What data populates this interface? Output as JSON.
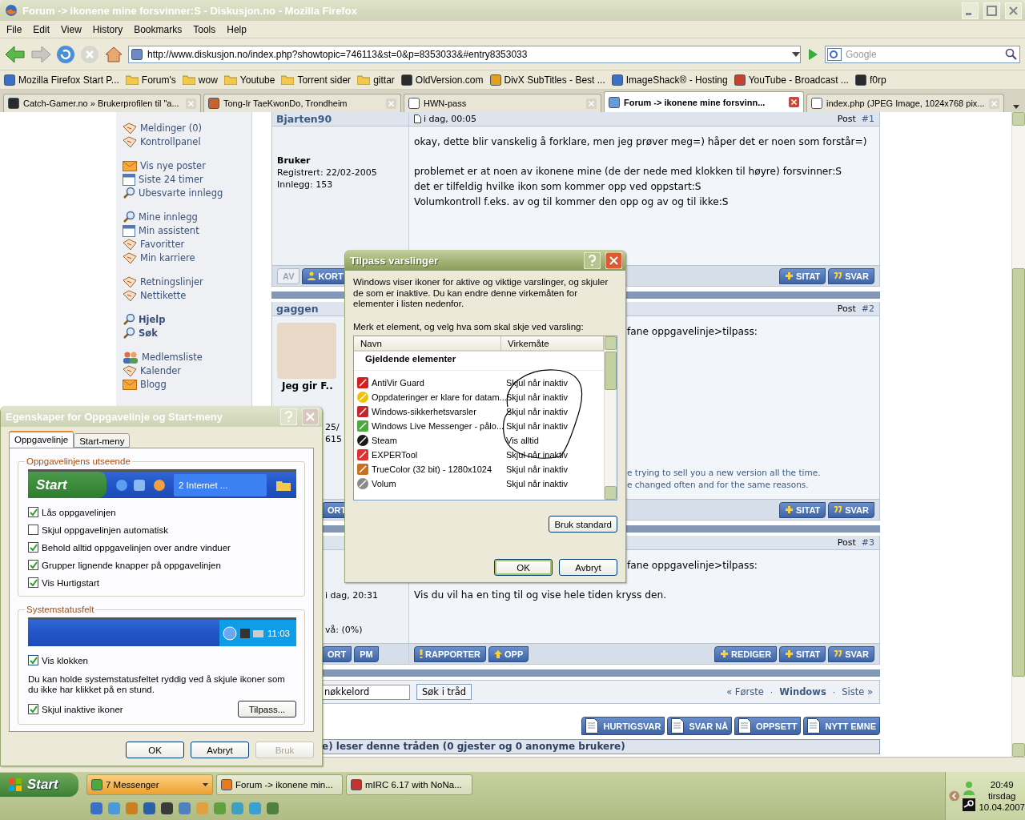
{
  "window": {
    "title": "Forum -> ikonene mine forsvinner:S - Diskusjon.no - Mozilla Firefox"
  },
  "menu": [
    "File",
    "Edit",
    "View",
    "History",
    "Bookmarks",
    "Tools",
    "Help"
  ],
  "address": {
    "url": "http://www.diskusjon.no/index.php?showtopic=746113&st=0&p=8353033&#entry8353033"
  },
  "search": {
    "placeholder": "Google"
  },
  "bookmarks": [
    {
      "label": "Mozilla Firefox Start P...",
      "kind": "page"
    },
    {
      "label": "Forum's",
      "kind": "folder"
    },
    {
      "label": "wow",
      "kind": "folder"
    },
    {
      "label": "Youtube",
      "kind": "folder"
    },
    {
      "label": "Torrent sider",
      "kind": "folder"
    },
    {
      "label": "gittar",
      "kind": "folder"
    },
    {
      "label": "OldVersion.com",
      "kind": "page"
    },
    {
      "label": "DivX SubTitles - Best ...",
      "kind": "page"
    },
    {
      "label": "ImageShack® - Hosting",
      "kind": "page"
    },
    {
      "label": "YouTube - Broadcast ...",
      "kind": "page"
    },
    {
      "label": "f0rp",
      "kind": "page"
    }
  ],
  "tabs": [
    {
      "label": "Catch-Gamer.no » Brukerprofilen til \"a...",
      "selected": false
    },
    {
      "label": "Tong-Ir TaeKwonDo, Trondheim",
      "selected": false
    },
    {
      "label": "HWN-pass",
      "selected": false
    },
    {
      "label": "Forum -> ikonene mine forsvinn...",
      "selected": true
    },
    {
      "label": "index.php (JPEG Image, 1024x768 pix...",
      "selected": false
    }
  ],
  "sidebar": {
    "groups": [
      [
        {
          "label": "Meldinger (0)",
          "kind": "page",
          "bold": false
        },
        {
          "label": "Kontrollpanel",
          "kind": "page",
          "bold": false
        }
      ],
      [
        {
          "label": "Vis nye poster",
          "kind": "mail",
          "bold": false
        },
        {
          "label": "Siste 24 timer",
          "kind": "calendar",
          "bold": false
        },
        {
          "label": "Ubesvarte innlegg",
          "kind": "search",
          "bold": false
        }
      ],
      [
        {
          "label": "Mine innlegg",
          "kind": "search",
          "bold": false
        },
        {
          "label": "Min assistent",
          "kind": "calendar",
          "bold": false
        },
        {
          "label": "Favoritter",
          "kind": "page",
          "bold": false
        },
        {
          "label": "Min karriere",
          "kind": "page",
          "bold": false
        }
      ],
      [
        {
          "label": "Retningslinjer",
          "kind": "page",
          "bold": false
        },
        {
          "label": "Nettikette",
          "kind": "page",
          "bold": false
        }
      ],
      [
        {
          "label": "Hjelp",
          "kind": "search",
          "bold": true
        },
        {
          "label": "Søk",
          "kind": "search",
          "bold": true
        }
      ],
      [
        {
          "label": "Medlemsliste",
          "kind": "people",
          "bold": false
        },
        {
          "label": "Kalender",
          "kind": "page",
          "bold": false
        },
        {
          "label": "Blogg",
          "kind": "mail",
          "bold": false
        }
      ]
    ]
  },
  "posts": [
    {
      "author": "Bjarten90",
      "date": "i dag, 00:05",
      "post_label": "Post",
      "post_number": "#1",
      "role": "Bruker",
      "details": [
        "Registrert: 22/02-2005",
        "Innlegg: 153"
      ],
      "message": [
        [
          "okay, dette blir vanskelig å forklare, men jeg prøver meg=) håper det er noen som forstår=)"
        ],
        [
          "problemet er at noen av ikonene mine (de der nede med klokken til høyre) forsvinner:S",
          "det er tilfeldig hvilke ikon som kommer opp ved oppstart:S",
          "Volumkontroll f.eks. av og til kommer den opp og av og til ikke:S"
        ]
      ],
      "left_buttons": [
        {
          "label": "AV",
          "kind": "muted"
        },
        {
          "label": "KORT",
          "kind": "user"
        }
      ],
      "right_buttons": [
        {
          "label": "SITAT",
          "kind": "plus"
        },
        {
          "label": "SVAR",
          "kind": "quote"
        }
      ]
    },
    {
      "author": "gaggen",
      "post_label": "Post",
      "post_number": "#2",
      "avatar_caption": "Jeg gir F..",
      "details": [
        "25/",
        "615"
      ],
      "message": [
        [
          "fane oppgavelinje>tilpass:"
        ]
      ],
      "signature": [
        "e trying to sell you a new version all the time.",
        "e changed often and for the same reasons."
      ],
      "left_buttons": [
        {
          "label": "ORT",
          "kind": "plain"
        }
      ],
      "right_buttons": [
        {
          "label": "SITAT",
          "kind": "plus"
        },
        {
          "label": "SVAR",
          "kind": "quote"
        }
      ]
    },
    {
      "post_label": "Post",
      "post_number": "#3",
      "details": [
        "i dag, 20:31",
        "vå: (0%)"
      ],
      "message": [
        [
          "fane oppgavelinje>tilpass:"
        ],
        [
          "Vis du vil ha en ting til og vise hele tiden kryss den."
        ]
      ],
      "left_buttons": [
        {
          "label": "ORT",
          "kind": "plain"
        },
        {
          "label": "PM",
          "kind": "plain"
        }
      ],
      "mid_buttons": [
        {
          "label": "RAPPORTER",
          "kind": "alert"
        },
        {
          "label": "OPP",
          "kind": "up"
        }
      ],
      "right_buttons": [
        {
          "label": "REDIGER",
          "kind": "plus"
        },
        {
          "label": "SITAT",
          "kind": "plus"
        },
        {
          "label": "SVAR",
          "kind": "quote"
        }
      ]
    }
  ],
  "thread_search": {
    "value": "nøkkelord",
    "button": "Søk i tråd"
  },
  "pagination": [
    {
      "label": "« Første",
      "kind": "link",
      "bold": false
    },
    {
      "label": "·",
      "kind": "dot"
    },
    {
      "label": "Windows",
      "kind": "link",
      "bold": true
    },
    {
      "label": "·",
      "kind": "dot"
    },
    {
      "label": "Siste »",
      "kind": "link",
      "bold": false
    }
  ],
  "thread_buttons": [
    "HURTIGSVAR",
    "SVAR NÅ",
    "OPPSETT",
    "NYTT EMNE"
  ],
  "readers": "e) leser denne tråden (0 gjester og 0 anonyme brukere)",
  "notify_dialog": {
    "title": "Tilpass varslinger",
    "description": "Windows viser ikoner for aktive og viktige varslinger, og skjuler de som er inaktive. Du kan endre denne virkemåten for elementer i listen nedenfor.",
    "prompt": "Merk et element, og velg hva som skal skje ved varsling:",
    "columns": [
      "Navn",
      "Virkemåte"
    ],
    "group": "Gjeldende elementer",
    "rows": [
      {
        "name": "AntiVir Guard",
        "behavior": "Skjul når inaktiv"
      },
      {
        "name": "Oppdateringer er klare for datam...",
        "behavior": "Skjul når inaktiv"
      },
      {
        "name": "Windows-sikkerhetsvarsler",
        "behavior": "Skjul når inaktiv"
      },
      {
        "name": "Windows Live Messenger - pålo...",
        "behavior": "Skjul når inaktiv"
      },
      {
        "name": "Steam",
        "behavior": "Vis alltid"
      },
      {
        "name": "EXPERTool",
        "behavior": "Skjul når inaktiv"
      },
      {
        "name": "TrueColor (32 bit) - 1280x1024",
        "behavior": "Skjul når inaktiv"
      },
      {
        "name": "Volum",
        "behavior": "Skjul når inaktiv"
      }
    ],
    "reset_button": "Bruk standard",
    "buttons": [
      {
        "label": "OK",
        "default": true
      },
      {
        "label": "Avbryt",
        "default": false
      }
    ]
  },
  "taskbar_dialog": {
    "title": "Egenskaper for Oppgavelinje og Start-meny",
    "tabs": [
      {
        "label": "Oppgavelinje",
        "selected": true
      },
      {
        "label": "Start-meny",
        "selected": false
      }
    ],
    "appearance": {
      "title": "Oppgavelinjens utseende",
      "preview_start": "Start",
      "preview_task": "2 Internet ...",
      "options": [
        {
          "label": "Lås oppgavelinjen",
          "checked": true
        },
        {
          "label": "Skjul oppgavelinjen automatisk",
          "checked": false
        },
        {
          "label": "Behold alltid oppgavelinjen over andre vinduer",
          "checked": true
        },
        {
          "label": "Grupper lignende knapper på oppgavelinjen",
          "checked": true
        },
        {
          "label": "Vis Hurtigstart",
          "checked": true
        }
      ]
    },
    "tray": {
      "title": "Systemstatusfelt",
      "preview_clock": "11:03",
      "clock_option": {
        "label": "Vis klokken",
        "checked": true
      },
      "hint": "Du kan holde systemstatusfeltet ryddig ved å skjule ikoner som du ikke har klikket på en stund.",
      "hide_option": {
        "label": "Skjul inaktive ikoner",
        "checked": true
      },
      "customize_button": "Tilpass..."
    },
    "buttons": [
      {
        "label": "OK",
        "disabled": false
      },
      {
        "label": "Avbryt",
        "disabled": false
      },
      {
        "label": "Bruk",
        "disabled": true
      }
    ]
  },
  "taskbar": {
    "start": "Start",
    "tasks": [
      {
        "label": "7 Messenger",
        "kind": "group",
        "flashing": true
      },
      {
        "label": "Forum -> ikonene min...",
        "kind": "window",
        "flashing": false
      },
      {
        "label": "mIRC 6.17 with NoNa...",
        "kind": "window",
        "flashing": false
      }
    ],
    "clock": {
      "time": "20:49",
      "day": "tirsdag",
      "date": "10.04.2007"
    }
  }
}
